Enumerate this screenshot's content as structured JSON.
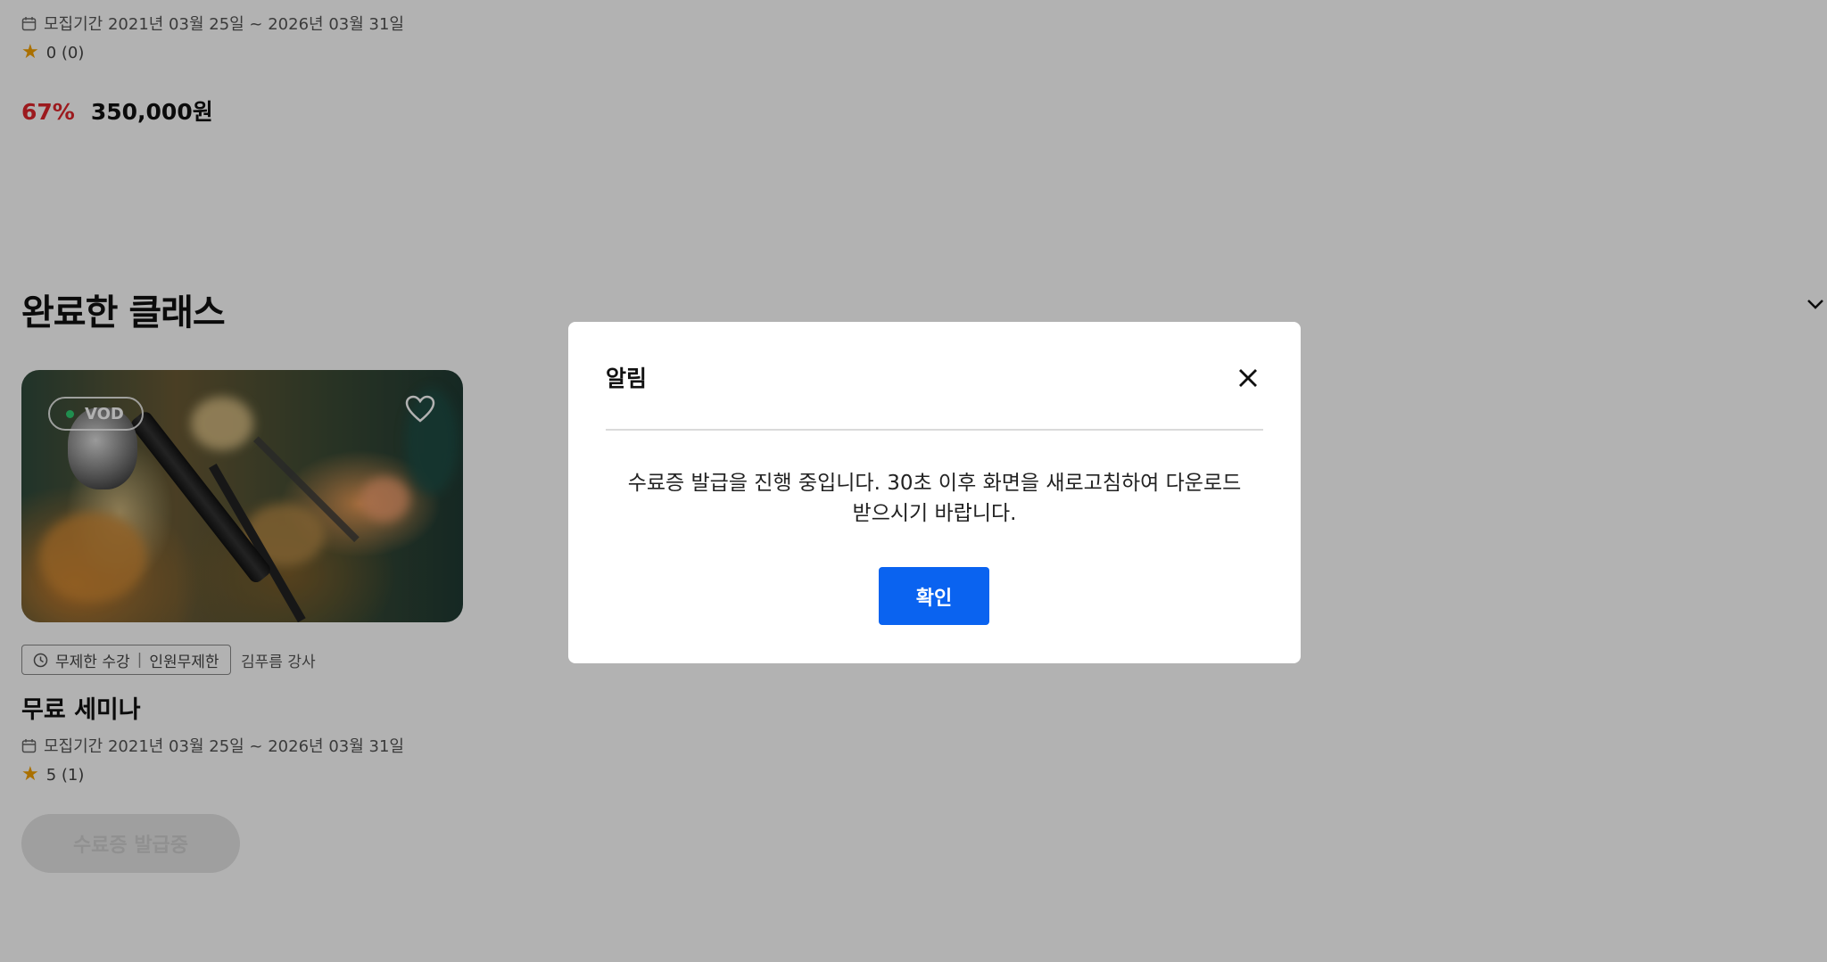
{
  "previous_class": {
    "period_text": "모집기간 2021년 03월 25일 ~ 2026년 03월 31일",
    "rating_text": "0 (0)",
    "discount": "67%",
    "price": "350,000원"
  },
  "completed_section": {
    "title": "완료한 클래스",
    "card": {
      "badge": "VOD",
      "tag_duration": "무제한 수강",
      "tag_capacity": "인원무제한",
      "instructor": "김푸름 강사",
      "title": "무료 세미나",
      "period_text": "모집기간 2021년 03월 25일 ~ 2026년 03월 31일",
      "rating_text": "5 (1)",
      "cert_button_label": "수료증 발급중"
    }
  },
  "modal": {
    "title": "알림",
    "message_line1": "수료증 발급을 진행 중입니다. 30초 이후 화면을 새로고침하여 다운로드",
    "message_line2": "받으시기 바랍니다.",
    "confirm_label": "확인"
  },
  "colors": {
    "accent": "#0a63f0",
    "discount": "#e0262b",
    "star": "#f4a100",
    "vod_dot": "#2ecc71"
  }
}
